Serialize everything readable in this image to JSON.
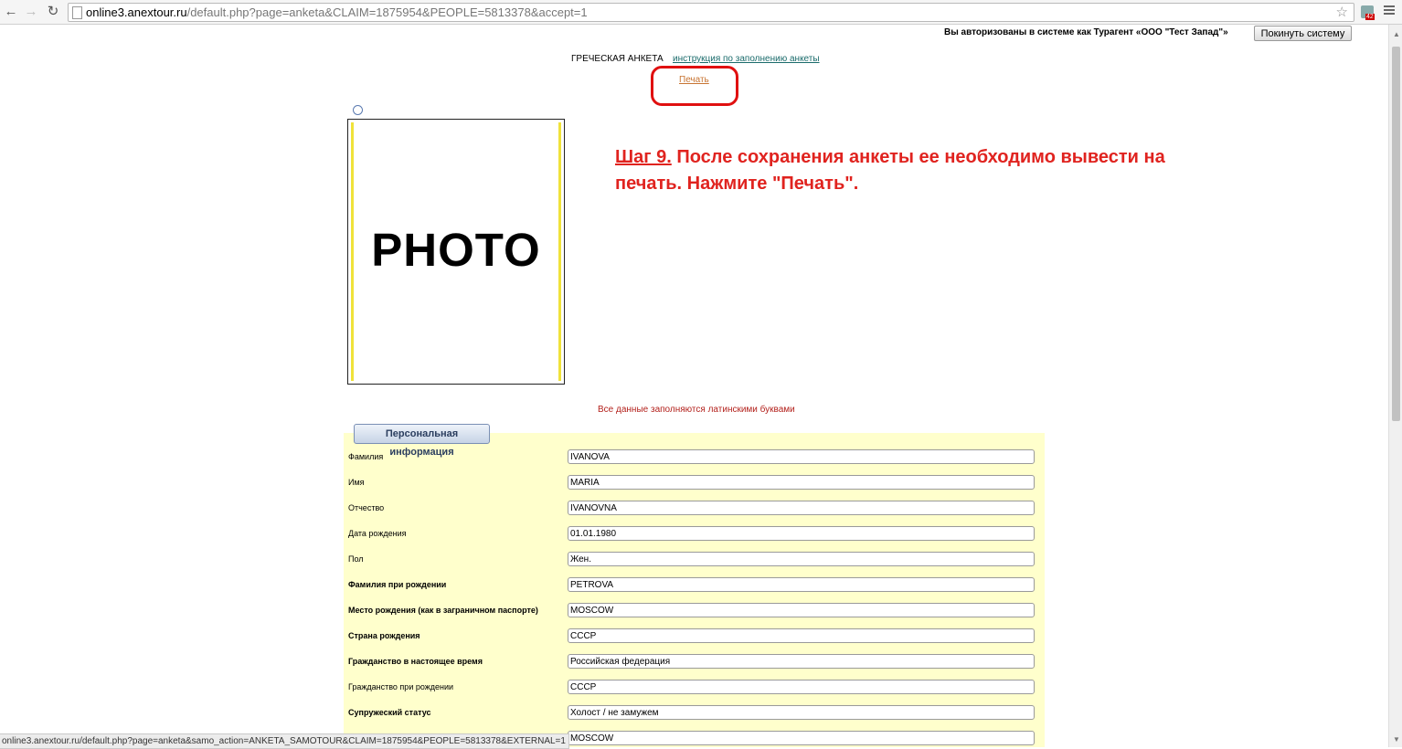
{
  "browser": {
    "url_host": "online3.anextour.ru",
    "url_rest": "/default.php?page=anketa&CLAIM=1875954&PEOPLE=5813378&accept=1",
    "ext_badge": "42",
    "status_url": "online3.anextour.ru/default.php?page=anketa&samo_action=ANKETA_SAMOTOUR&CLAIM=1875954&PEOPLE=5813378&EXTERNAL=1"
  },
  "header": {
    "auth_text": "Вы авторизованы в системе как Турагент «ООО \"Тест Запад\"»",
    "logout_label": "Покинуть систему"
  },
  "page": {
    "form_title": "ГРЕЧЕСКАЯ АНКЕТА",
    "instruction_link": "инструкция по заполнению анкеты",
    "print_link": "Печать",
    "photo_text": "PHOTO",
    "latin_note": "Все данные заполняются латинскими буквами"
  },
  "annotation": {
    "step_label": "Шаг 9.",
    "step_text": " После сохранения анкеты ее необходимо вывести на печать. Нажмите \"Печать\".",
    "highlight_color": "#e01010"
  },
  "form": {
    "legend": "Персональная информация",
    "fields": [
      {
        "label": "Фамилия",
        "value": "IVANOVA",
        "bold": false
      },
      {
        "label": "Имя",
        "value": "MARIA",
        "bold": false
      },
      {
        "label": "Отчество",
        "value": "IVANOVNA",
        "bold": false
      },
      {
        "label": "Дата рождения",
        "value": "01.01.1980",
        "bold": false
      },
      {
        "label": "Пол",
        "value": "Жен.",
        "bold": false
      },
      {
        "label": "Фамилия при рождении",
        "value": "PETROVA",
        "bold": true
      },
      {
        "label": "Место рождения (как в заграничном паспорте)",
        "value": "MOSCOW",
        "bold": true
      },
      {
        "label": "Страна рождения",
        "value": "СССР",
        "bold": true
      },
      {
        "label": "Гражданство в настоящее время",
        "value": "Российская федерация",
        "bold": true
      },
      {
        "label": "Гражданство при рождении",
        "value": "СССР",
        "bold": false
      },
      {
        "label": "Супружеский статус",
        "value": "Холост / не замужем",
        "bold": true
      },
      {
        "label": "",
        "value": "MOSCOW",
        "bold": false
      }
    ]
  }
}
